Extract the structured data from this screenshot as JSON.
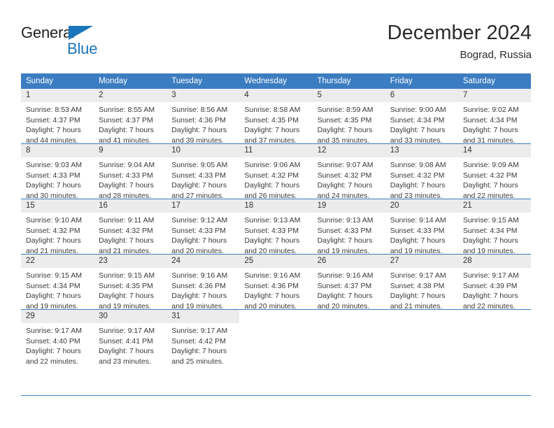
{
  "brand": {
    "name_top": "General",
    "name_bottom": "Blue",
    "triangle_icon": "triangle-icon",
    "accent_color": "#1b75bb"
  },
  "header": {
    "title": "December 2024",
    "subtitle": "Bograd, Russia"
  },
  "theme": {
    "header_blue": "#3b7dc0",
    "daynum_band": "#ececec",
    "text": "#2b2b2b"
  },
  "weekdays": [
    "Sunday",
    "Monday",
    "Tuesday",
    "Wednesday",
    "Thursday",
    "Friday",
    "Saturday"
  ],
  "weeks": [
    [
      {
        "day": "1",
        "sunrise": "Sunrise: 8:53 AM",
        "sunset": "Sunset: 4:37 PM",
        "daylight_1": "Daylight: 7 hours",
        "daylight_2": "and 44 minutes."
      },
      {
        "day": "2",
        "sunrise": "Sunrise: 8:55 AM",
        "sunset": "Sunset: 4:37 PM",
        "daylight_1": "Daylight: 7 hours",
        "daylight_2": "and 41 minutes."
      },
      {
        "day": "3",
        "sunrise": "Sunrise: 8:56 AM",
        "sunset": "Sunset: 4:36 PM",
        "daylight_1": "Daylight: 7 hours",
        "daylight_2": "and 39 minutes."
      },
      {
        "day": "4",
        "sunrise": "Sunrise: 8:58 AM",
        "sunset": "Sunset: 4:35 PM",
        "daylight_1": "Daylight: 7 hours",
        "daylight_2": "and 37 minutes."
      },
      {
        "day": "5",
        "sunrise": "Sunrise: 8:59 AM",
        "sunset": "Sunset: 4:35 PM",
        "daylight_1": "Daylight: 7 hours",
        "daylight_2": "and 35 minutes."
      },
      {
        "day": "6",
        "sunrise": "Sunrise: 9:00 AM",
        "sunset": "Sunset: 4:34 PM",
        "daylight_1": "Daylight: 7 hours",
        "daylight_2": "and 33 minutes."
      },
      {
        "day": "7",
        "sunrise": "Sunrise: 9:02 AM",
        "sunset": "Sunset: 4:34 PM",
        "daylight_1": "Daylight: 7 hours",
        "daylight_2": "and 31 minutes."
      }
    ],
    [
      {
        "day": "8",
        "sunrise": "Sunrise: 9:03 AM",
        "sunset": "Sunset: 4:33 PM",
        "daylight_1": "Daylight: 7 hours",
        "daylight_2": "and 30 minutes."
      },
      {
        "day": "9",
        "sunrise": "Sunrise: 9:04 AM",
        "sunset": "Sunset: 4:33 PM",
        "daylight_1": "Daylight: 7 hours",
        "daylight_2": "and 28 minutes."
      },
      {
        "day": "10",
        "sunrise": "Sunrise: 9:05 AM",
        "sunset": "Sunset: 4:33 PM",
        "daylight_1": "Daylight: 7 hours",
        "daylight_2": "and 27 minutes."
      },
      {
        "day": "11",
        "sunrise": "Sunrise: 9:06 AM",
        "sunset": "Sunset: 4:32 PM",
        "daylight_1": "Daylight: 7 hours",
        "daylight_2": "and 26 minutes."
      },
      {
        "day": "12",
        "sunrise": "Sunrise: 9:07 AM",
        "sunset": "Sunset: 4:32 PM",
        "daylight_1": "Daylight: 7 hours",
        "daylight_2": "and 24 minutes."
      },
      {
        "day": "13",
        "sunrise": "Sunrise: 9:08 AM",
        "sunset": "Sunset: 4:32 PM",
        "daylight_1": "Daylight: 7 hours",
        "daylight_2": "and 23 minutes."
      },
      {
        "day": "14",
        "sunrise": "Sunrise: 9:09 AM",
        "sunset": "Sunset: 4:32 PM",
        "daylight_1": "Daylight: 7 hours",
        "daylight_2": "and 22 minutes."
      }
    ],
    [
      {
        "day": "15",
        "sunrise": "Sunrise: 9:10 AM",
        "sunset": "Sunset: 4:32 PM",
        "daylight_1": "Daylight: 7 hours",
        "daylight_2": "and 21 minutes."
      },
      {
        "day": "16",
        "sunrise": "Sunrise: 9:11 AM",
        "sunset": "Sunset: 4:32 PM",
        "daylight_1": "Daylight: 7 hours",
        "daylight_2": "and 21 minutes."
      },
      {
        "day": "17",
        "sunrise": "Sunrise: 9:12 AM",
        "sunset": "Sunset: 4:33 PM",
        "daylight_1": "Daylight: 7 hours",
        "daylight_2": "and 20 minutes."
      },
      {
        "day": "18",
        "sunrise": "Sunrise: 9:13 AM",
        "sunset": "Sunset: 4:33 PM",
        "daylight_1": "Daylight: 7 hours",
        "daylight_2": "and 20 minutes."
      },
      {
        "day": "19",
        "sunrise": "Sunrise: 9:13 AM",
        "sunset": "Sunset: 4:33 PM",
        "daylight_1": "Daylight: 7 hours",
        "daylight_2": "and 19 minutes."
      },
      {
        "day": "20",
        "sunrise": "Sunrise: 9:14 AM",
        "sunset": "Sunset: 4:33 PM",
        "daylight_1": "Daylight: 7 hours",
        "daylight_2": "and 19 minutes."
      },
      {
        "day": "21",
        "sunrise": "Sunrise: 9:15 AM",
        "sunset": "Sunset: 4:34 PM",
        "daylight_1": "Daylight: 7 hours",
        "daylight_2": "and 19 minutes."
      }
    ],
    [
      {
        "day": "22",
        "sunrise": "Sunrise: 9:15 AM",
        "sunset": "Sunset: 4:34 PM",
        "daylight_1": "Daylight: 7 hours",
        "daylight_2": "and 19 minutes."
      },
      {
        "day": "23",
        "sunrise": "Sunrise: 9:15 AM",
        "sunset": "Sunset: 4:35 PM",
        "daylight_1": "Daylight: 7 hours",
        "daylight_2": "and 19 minutes."
      },
      {
        "day": "24",
        "sunrise": "Sunrise: 9:16 AM",
        "sunset": "Sunset: 4:36 PM",
        "daylight_1": "Daylight: 7 hours",
        "daylight_2": "and 19 minutes."
      },
      {
        "day": "25",
        "sunrise": "Sunrise: 9:16 AM",
        "sunset": "Sunset: 4:36 PM",
        "daylight_1": "Daylight: 7 hours",
        "daylight_2": "and 20 minutes."
      },
      {
        "day": "26",
        "sunrise": "Sunrise: 9:16 AM",
        "sunset": "Sunset: 4:37 PM",
        "daylight_1": "Daylight: 7 hours",
        "daylight_2": "and 20 minutes."
      },
      {
        "day": "27",
        "sunrise": "Sunrise: 9:17 AM",
        "sunset": "Sunset: 4:38 PM",
        "daylight_1": "Daylight: 7 hours",
        "daylight_2": "and 21 minutes."
      },
      {
        "day": "28",
        "sunrise": "Sunrise: 9:17 AM",
        "sunset": "Sunset: 4:39 PM",
        "daylight_1": "Daylight: 7 hours",
        "daylight_2": "and 22 minutes."
      }
    ],
    [
      {
        "day": "29",
        "sunrise": "Sunrise: 9:17 AM",
        "sunset": "Sunset: 4:40 PM",
        "daylight_1": "Daylight: 7 hours",
        "daylight_2": "and 22 minutes."
      },
      {
        "day": "30",
        "sunrise": "Sunrise: 9:17 AM",
        "sunset": "Sunset: 4:41 PM",
        "daylight_1": "Daylight: 7 hours",
        "daylight_2": "and 23 minutes."
      },
      {
        "day": "31",
        "sunrise": "Sunrise: 9:17 AM",
        "sunset": "Sunset: 4:42 PM",
        "daylight_1": "Daylight: 7 hours",
        "daylight_2": "and 25 minutes."
      },
      {
        "day": "",
        "sunrise": "",
        "sunset": "",
        "daylight_1": "",
        "daylight_2": ""
      },
      {
        "day": "",
        "sunrise": "",
        "sunset": "",
        "daylight_1": "",
        "daylight_2": ""
      },
      {
        "day": "",
        "sunrise": "",
        "sunset": "",
        "daylight_1": "",
        "daylight_2": ""
      },
      {
        "day": "",
        "sunrise": "",
        "sunset": "",
        "daylight_1": "",
        "daylight_2": ""
      }
    ]
  ]
}
